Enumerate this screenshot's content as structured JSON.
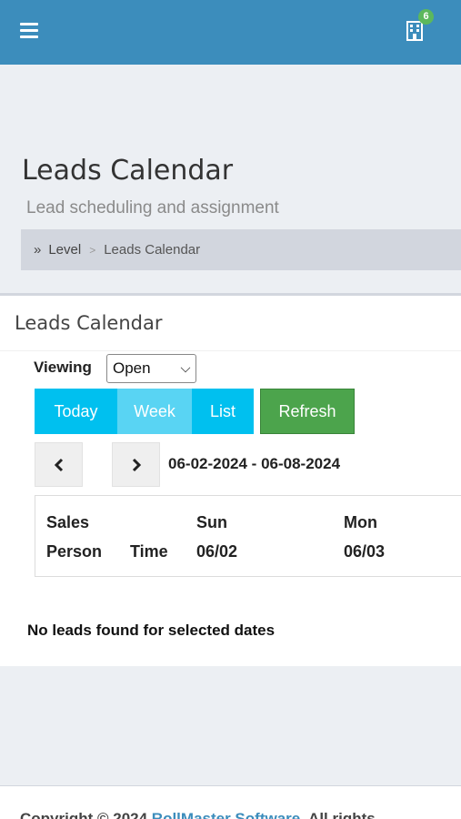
{
  "header": {
    "menu_icon": "hamburger-menu-icon",
    "building_icon": "building-icon",
    "notification_count": "6",
    "colors": {
      "bar": "#3c8dbc",
      "badge": "#5cb85c"
    }
  },
  "page": {
    "title": "Leads Calendar",
    "subtitle": "Lead scheduling and assignment"
  },
  "breadcrumb": {
    "icon": "double-chevron-right-icon",
    "level": "Level",
    "separator": ">",
    "current": "Leads Calendar"
  },
  "box": {
    "title": "Leads Calendar",
    "viewing_label": "Viewing",
    "viewing_value": "Open",
    "buttons": {
      "today": "Today",
      "week": "Week",
      "list": "List",
      "refresh": "Refresh"
    },
    "date_range": "06-02-2024 - 06-08-2024",
    "table_headers": {
      "sales_person_1": "Sales",
      "sales_person_2": "Person",
      "time": "Time",
      "day1_name": "Sun",
      "day1_date": "06/02",
      "day2_name": "Mon",
      "day2_date": "06/03"
    },
    "empty_message": "No leads found for selected dates"
  },
  "footer": {
    "prefix": "Copyright © 2024 ",
    "link": "RollMaster Software",
    "suffix": ". All rights"
  }
}
